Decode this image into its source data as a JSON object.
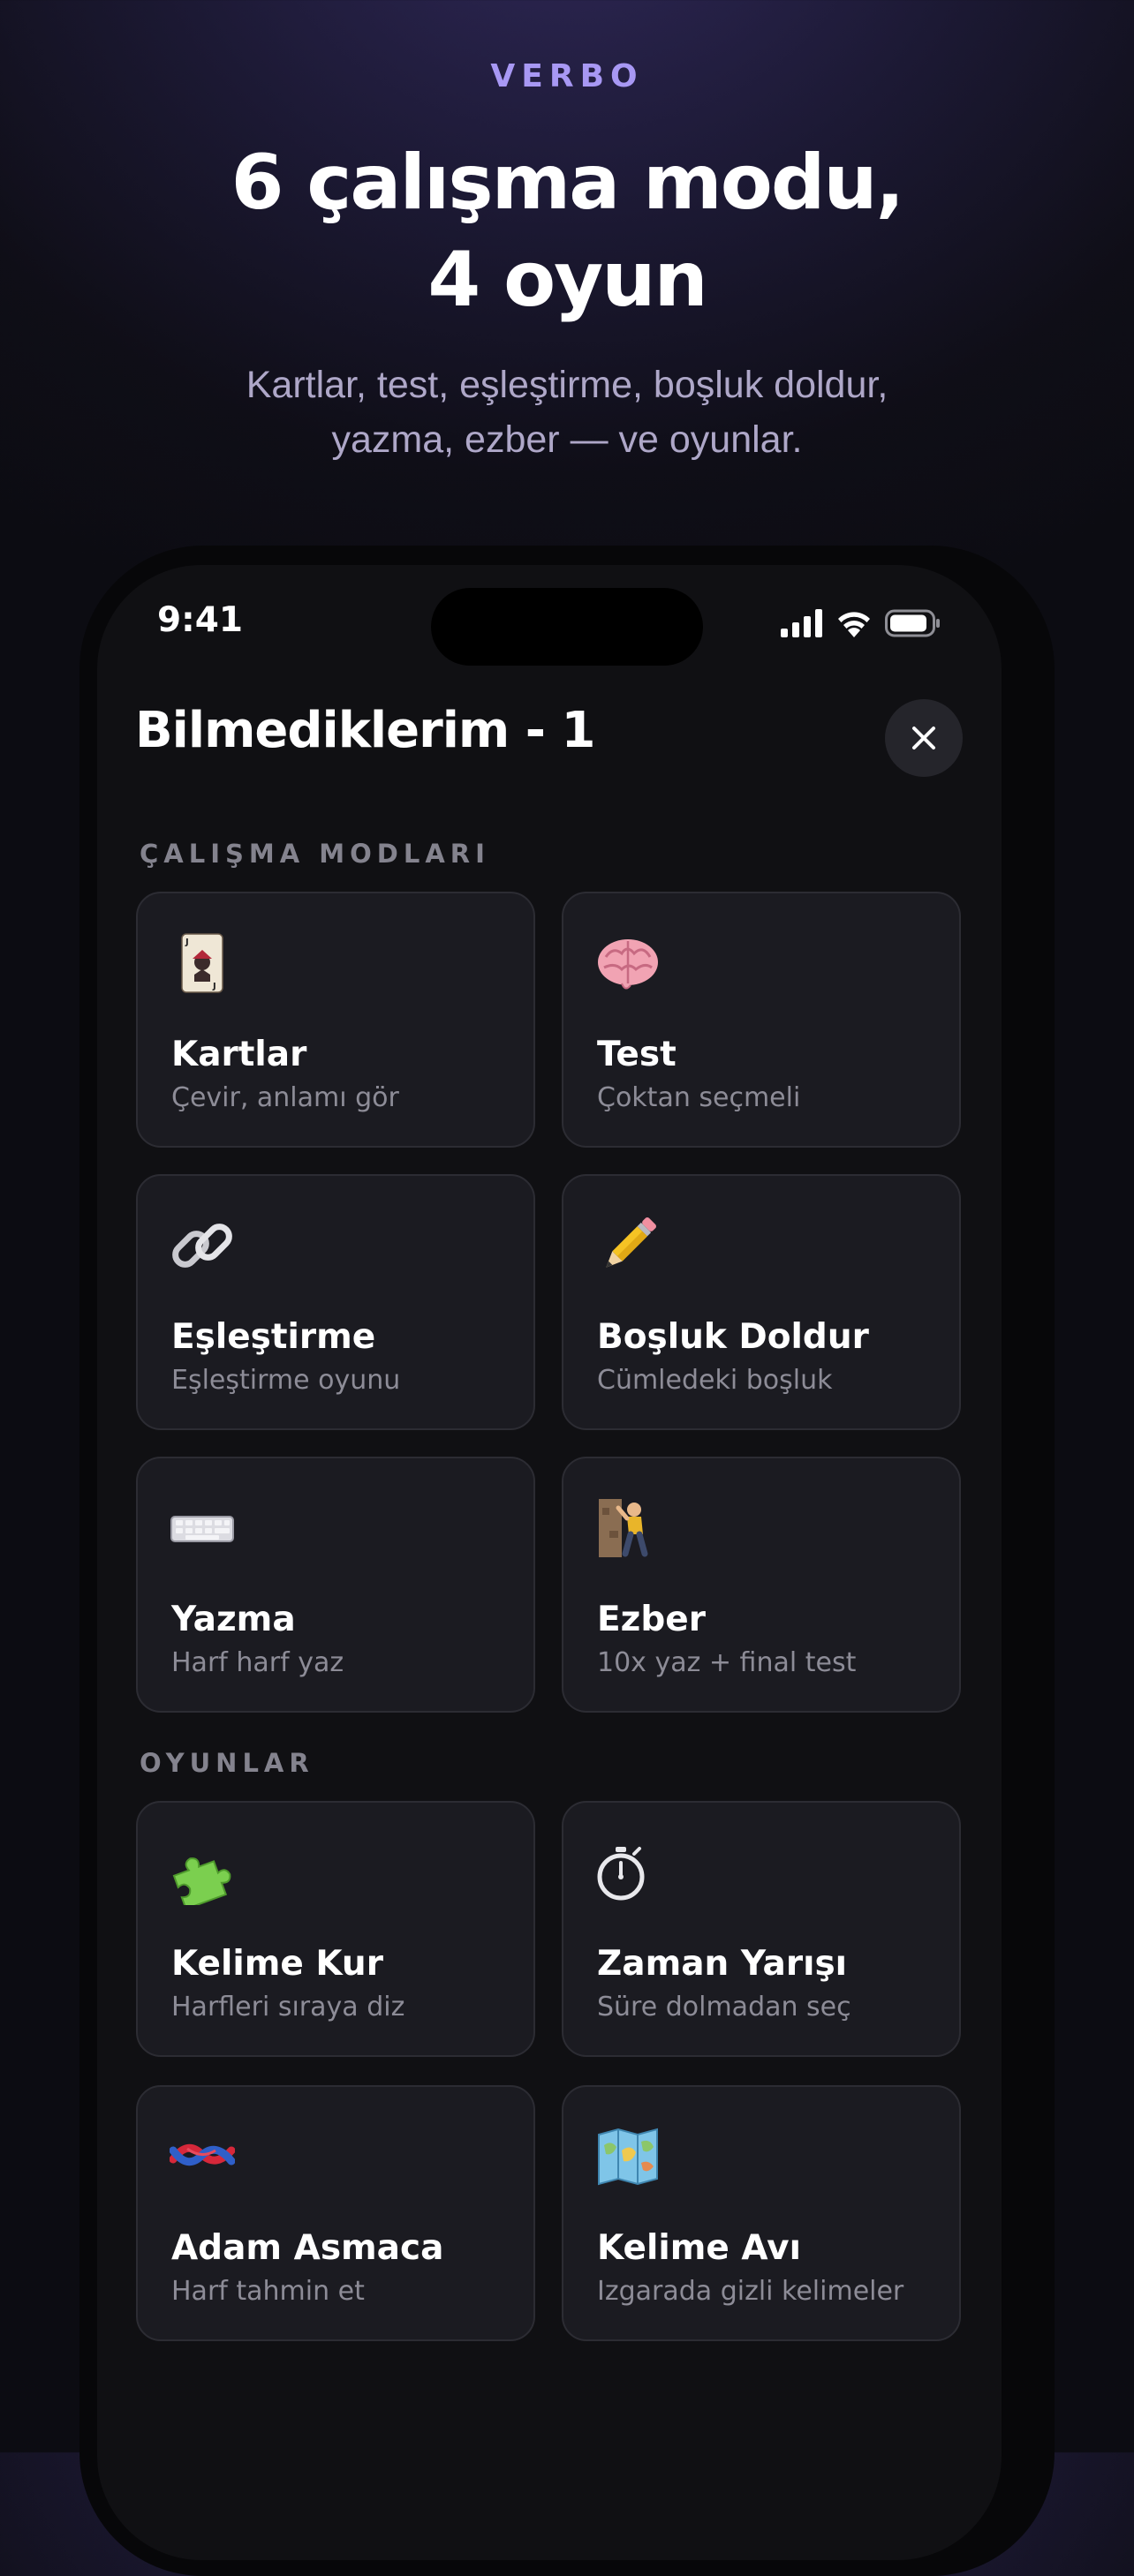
{
  "header": {
    "brand": "VERBO",
    "headline_line1": "6 çalışma modu,",
    "headline_line2": "4 oyun",
    "subtitle_line1": "Kartlar, test, eşleştirme, boşluk doldur,",
    "subtitle_line2": "yazma, ezber — ve oyunlar."
  },
  "status_bar": {
    "time": "9:41"
  },
  "sheet": {
    "title": "Bilmediklerim - 1",
    "study_section_label": "ÇALIŞMA MODLARI",
    "games_section_label": "OYUNLAR"
  },
  "study_modes": [
    {
      "name": "Kartlar",
      "desc": "Çevir, anlamı gör",
      "icon": "joker-card-icon"
    },
    {
      "name": "Test",
      "desc": "Çoktan seçmeli",
      "icon": "brain-icon"
    },
    {
      "name": "Eşleştirme",
      "desc": "Eşleştirme oyunu",
      "icon": "link-icon"
    },
    {
      "name": "Boşluk Doldur",
      "desc": "Cümledeki boşluk",
      "icon": "pencil-icon"
    },
    {
      "name": "Yazma",
      "desc": "Harf harf yaz",
      "icon": "keyboard-icon"
    },
    {
      "name": "Ezber",
      "desc": "10x yaz + final test",
      "icon": "climber-icon"
    }
  ],
  "games": [
    {
      "name": "Kelime Kur",
      "desc": "Harfleri sıraya diz",
      "icon": "puzzle-icon"
    },
    {
      "name": "Zaman Yarışı",
      "desc": "Süre dolmadan seç",
      "icon": "stopwatch-icon"
    },
    {
      "name": "Adam Asmaca",
      "desc": "Harf tahmin et",
      "icon": "knot-icon"
    },
    {
      "name": "Kelime Avı",
      "desc": "Izgarada gizli kelimeler",
      "icon": "map-icon"
    }
  ],
  "colors": {
    "brand_accent": "#a898f4",
    "card_background": "#1b1b21",
    "card_border": "#2c2c33",
    "muted_text": "#8d8c97"
  }
}
